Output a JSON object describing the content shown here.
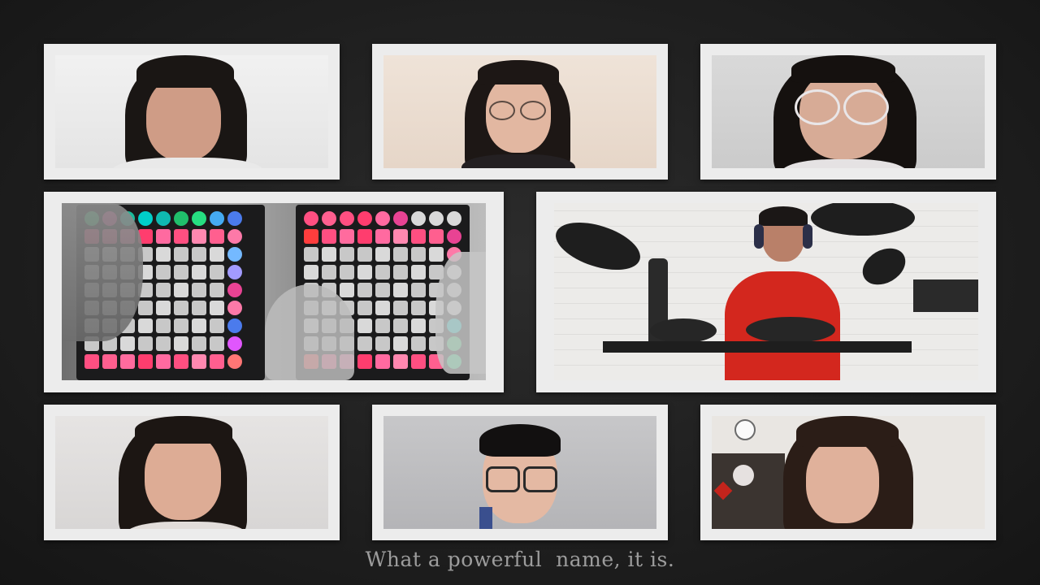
{
  "call": {
    "participants": [
      {
        "id": "p1",
        "description": "girl-with-bangs"
      },
      {
        "id": "p2",
        "description": "girl-with-glasses"
      },
      {
        "id": "p3",
        "description": "girl-with-round-glasses"
      },
      {
        "id": "p4",
        "description": "launchpad-player"
      },
      {
        "id": "p5",
        "description": "drummer"
      },
      {
        "id": "p6",
        "description": "girl-long-hair"
      },
      {
        "id": "p7",
        "description": "boy-with-glasses"
      },
      {
        "id": "p8",
        "description": "girl-side-hair"
      }
    ]
  },
  "caption": {
    "text": "What a powerful  name, it is."
  },
  "colors": {
    "background": "#1c1c1c",
    "tile_frame": "#ececec",
    "caption_text": "#9c9c9c"
  }
}
